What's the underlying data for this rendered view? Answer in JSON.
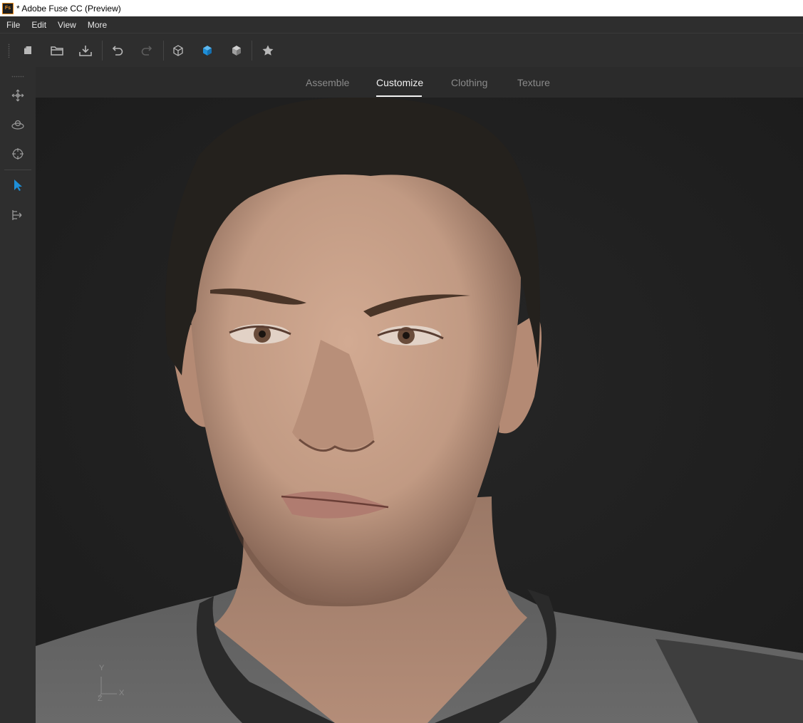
{
  "window": {
    "title": "* Adobe Fuse CC (Preview)",
    "app_icon": "Fs"
  },
  "menu": {
    "items": [
      "File",
      "Edit",
      "View",
      "More"
    ]
  },
  "toolbar": {
    "buttons": [
      {
        "icon": "new-file-icon"
      },
      {
        "icon": "open-folder-icon"
      },
      {
        "icon": "save-download-icon"
      },
      {
        "icon": "undo-icon"
      },
      {
        "icon": "redo-icon"
      },
      {
        "icon": "wireframe-cube-icon"
      },
      {
        "icon": "solid-cube-icon",
        "active": true
      },
      {
        "icon": "shaded-cube-icon"
      },
      {
        "icon": "star-icon"
      }
    ],
    "accent": "#1e8fd8"
  },
  "left_rail": {
    "tools": [
      {
        "icon": "move-icon"
      },
      {
        "icon": "orbit-icon"
      },
      {
        "icon": "target-icon"
      },
      {
        "icon": "select-arrow-icon",
        "active": true
      },
      {
        "icon": "scale-arrow-icon"
      }
    ]
  },
  "tabs": {
    "items": [
      "Assemble",
      "Customize",
      "Clothing",
      "Texture"
    ],
    "active": "Customize"
  },
  "viewport": {
    "axis": {
      "y": "Y",
      "x": "X",
      "z": "Z"
    },
    "background": "#1f1f1f"
  }
}
